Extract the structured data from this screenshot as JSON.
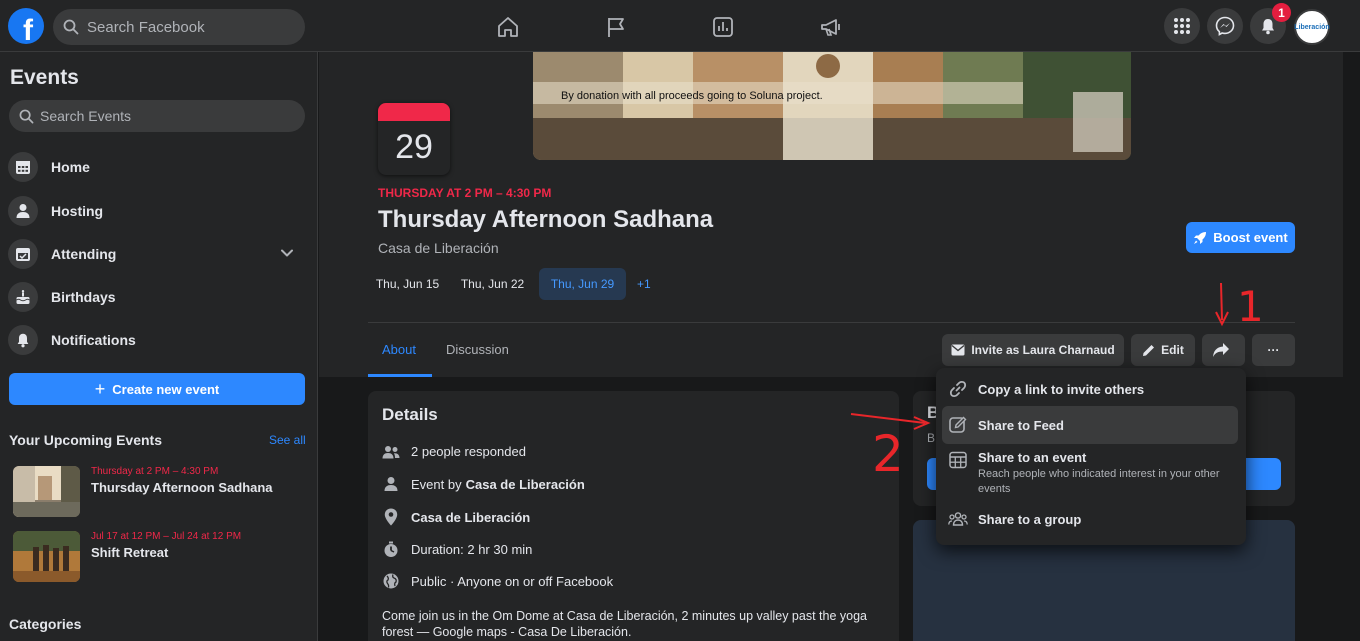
{
  "topbar": {
    "logo": "f",
    "search_placeholder": "Search Facebook",
    "notification_count": "1",
    "avatar_text": "Liberación"
  },
  "sidebar": {
    "title": "Events",
    "search_placeholder": "Search Events",
    "items": [
      {
        "label": "Home",
        "icon": "calendar-grid-icon"
      },
      {
        "label": "Hosting",
        "icon": "person-icon"
      },
      {
        "label": "Attending",
        "icon": "calendar-check-icon"
      },
      {
        "label": "Birthdays",
        "icon": "cake-icon"
      },
      {
        "label": "Notifications",
        "icon": "bell-icon"
      }
    ],
    "create_label": "Create new event",
    "upcoming_title": "Your Upcoming Events",
    "see_all": "See all",
    "upcoming": [
      {
        "date": "Thursday at 2 PM – 4:30 PM",
        "name": "Thursday Afternoon Sadhana"
      },
      {
        "date": "Jul 17 at 12 PM – Jul 24 at 12 PM",
        "name": "Shift Retreat"
      }
    ],
    "categories_title": "Categories"
  },
  "event": {
    "cover_caption": "By donation with  all proceeds going to Soluna project.",
    "day": "29",
    "time": "THURSDAY AT 2 PM – 4:30 PM",
    "title": "Thursday Afternoon Sadhana",
    "host": "Casa de Liberación",
    "boost_label": "Boost event",
    "dates": [
      "Thu, Jun 15",
      "Thu, Jun 22",
      "Thu, Jun 29"
    ],
    "dates_more": "+1",
    "tabs": [
      "About",
      "Discussion"
    ],
    "invite_label": "Invite as Laura Charnaud",
    "edit_label": "Edit",
    "more_label": "···"
  },
  "details": {
    "title": "Details",
    "responded": "2 people responded",
    "event_by_prefix": "Event by",
    "event_by_name": "Casa de Liberación",
    "location": "Casa de Liberación",
    "duration": "Duration: 2 hr 30 min",
    "privacy": "Public · Anyone on or off Facebook",
    "description": "Come join us in the Om Dome at Casa de Liberación, 2 minutes up valley past the yoga forest — Google maps - Casa De Liberación."
  },
  "right_card": {
    "title": "B",
    "subtitle": "B"
  },
  "share_menu": {
    "items": [
      {
        "label": "Copy a link to invite others",
        "icon": "link-icon"
      },
      {
        "label": "Share to Feed",
        "icon": "pencil-square-icon"
      },
      {
        "label": "Share to an event",
        "sub": "Reach people who indicated interest in your other events",
        "icon": "calendar-grid-icon"
      },
      {
        "label": "Share to a group",
        "icon": "group-icon"
      }
    ]
  },
  "annotations": {
    "one": "1",
    "two": "2"
  },
  "colors": {
    "accent": "#2d88ff",
    "event_red": "#f02849",
    "annotation": "#e8262a"
  }
}
